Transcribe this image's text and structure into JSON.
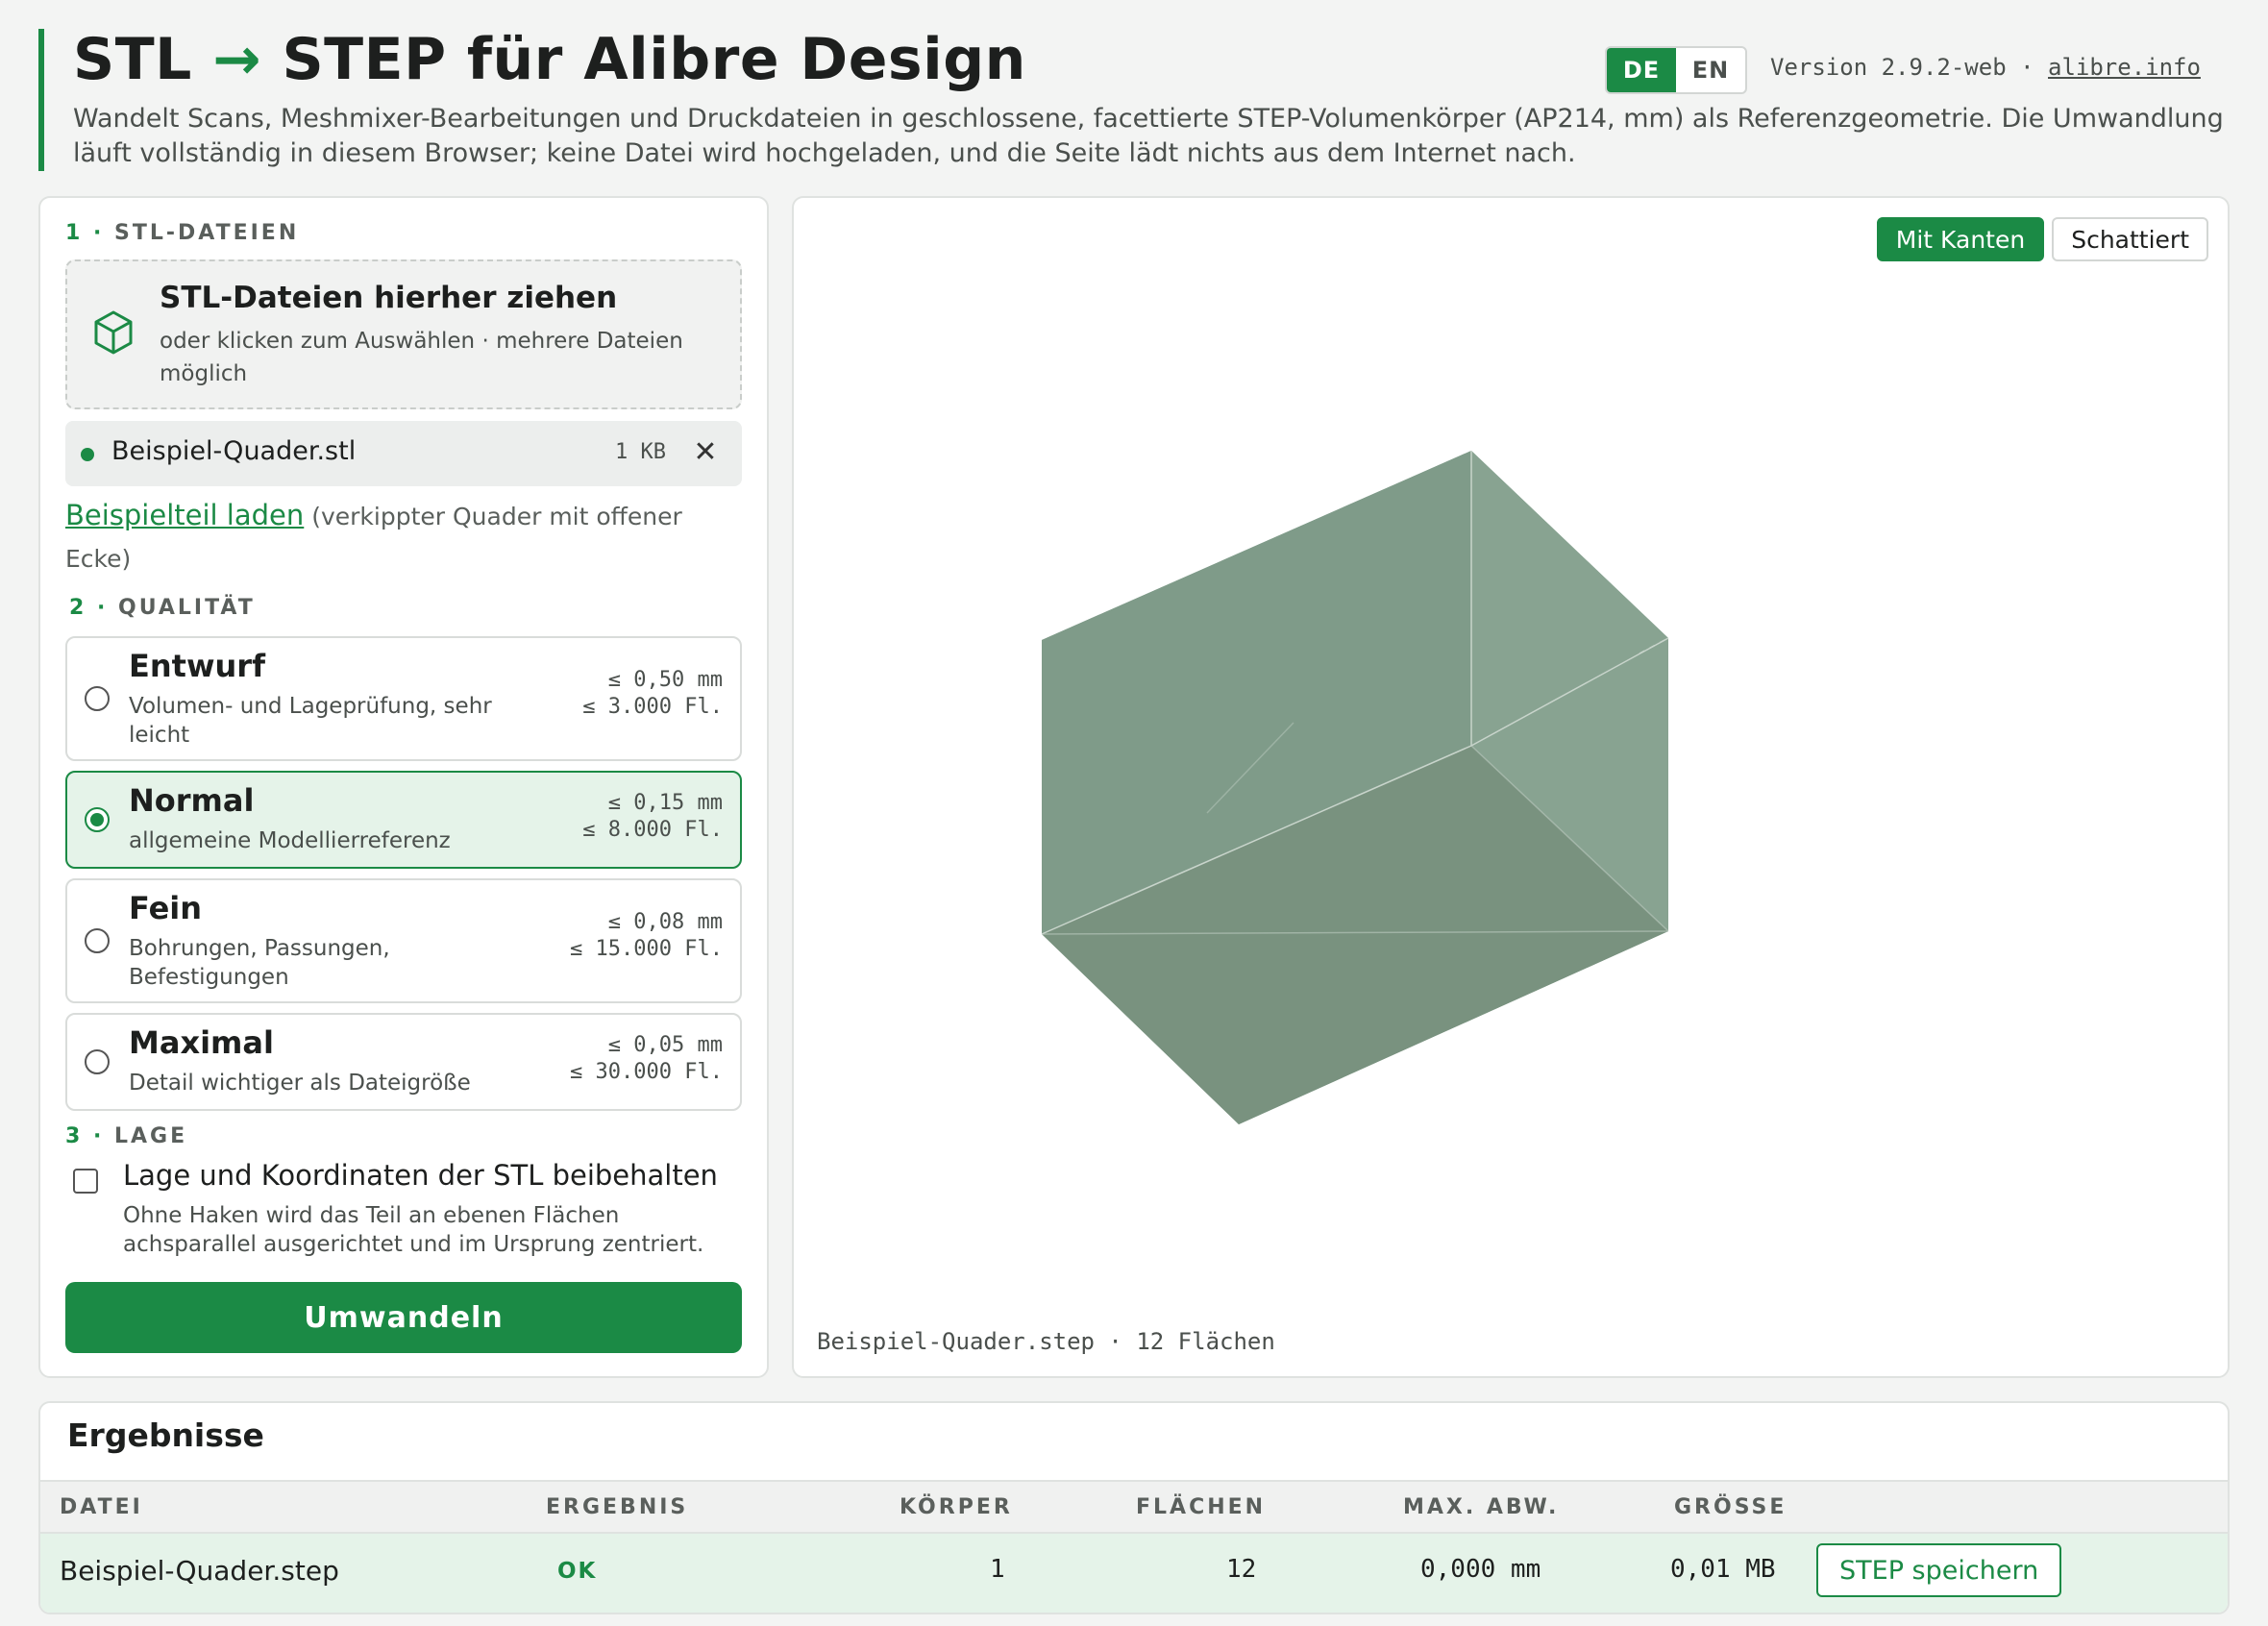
{
  "header": {
    "title_left": "STL",
    "title_arrow": "→",
    "title_right": "STEP für Alibre Design",
    "subtitle": "Wandelt Scans, Meshmixer-Bearbeitungen und Druckdateien in geschlossene, facettierte STEP-Volumenkörper (AP214, mm) als Referenzgeometrie. Die Umwandlung läuft vollständig in diesem Browser; keine Datei wird hochgeladen, und die Seite lädt nichts aus dem Internet nach.",
    "lang_de": "DE",
    "lang_en": "EN",
    "active_lang": "DE",
    "version": "Version 2.9.2-web",
    "separator": " · ",
    "site_link": "alibre.info"
  },
  "files_section": {
    "number": "1",
    "dot": " · ",
    "heading": "STL-DATEIEN",
    "drop_title": "STL-Dateien hierher ziehen",
    "drop_sub": "oder klicken zum Auswählen · mehrere Dateien möglich",
    "drop_icon": "cube-icon",
    "file": {
      "name": "Beispiel-Quader.stl",
      "size": "1 KB",
      "remove": "✕"
    },
    "sample_link": "Beispielteil laden",
    "sample_note": " (verkippter Quader mit offener Ecke)"
  },
  "quality_section": {
    "number": "2",
    "dot": " · ",
    "heading": "QUALITÄT",
    "selected": "Normal",
    "options": [
      {
        "name": "Entwurf",
        "desc": "Volumen- und Lageprüfung, sehr leicht",
        "tolerance": "≤ 0,50 mm",
        "faces": "≤ 3.000 Fl."
      },
      {
        "name": "Normal",
        "desc": "allgemeine Modellierreferenz",
        "tolerance": "≤ 0,15 mm",
        "faces": "≤ 8.000 Fl."
      },
      {
        "name": "Fein",
        "desc": "Bohrungen, Passungen, Befestigungen",
        "tolerance": "≤ 0,08 mm",
        "faces": "≤ 15.000 Fl."
      },
      {
        "name": "Maximal",
        "desc": "Detail wichtiger als Dateigröße",
        "tolerance": "≤ 0,05 mm",
        "faces": "≤ 30.000 Fl."
      }
    ]
  },
  "position_section": {
    "number": "3",
    "dot": " · ",
    "heading": "LAGE",
    "checkbox_label": "Lage und Koordinaten der STL beibehalten",
    "checked": false,
    "help": "Ohne Haken wird das Teil an ebenen Flächen achsparallel ausgerichtet und im Ursprung zentriert."
  },
  "convert_button": "Umwandeln",
  "viewer": {
    "mode_edges": "Mit Kanten",
    "mode_shaded": "Schattiert",
    "active_mode": "Mit Kanten",
    "caption": "Beispiel-Quader.step · 12 Flächen",
    "model_color": "#7e9b89"
  },
  "results": {
    "title": "Ergebnisse",
    "columns": [
      "DATEI",
      "ERGEBNIS",
      "KÖRPER",
      "FLÄCHEN",
      "MAX. ABW.",
      "GRÖSSE"
    ],
    "rows": [
      {
        "file": "Beispiel-Quader.step",
        "result": "OK",
        "bodies": "1",
        "faces": "12",
        "max_dev": "0,000 mm",
        "size": "0,01 MB",
        "action": "STEP speichern"
      }
    ]
  },
  "colors": {
    "accent": "#1b8a45",
    "selected_bg": "#e5f3e9",
    "page_bg": "#f3f4f3"
  }
}
